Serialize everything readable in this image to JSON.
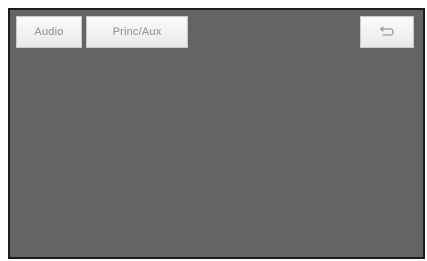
{
  "header": {
    "audio_label": "Audio",
    "source_label": "Princ/Aux",
    "back_icon": "back-arrow-icon"
  },
  "colors": {
    "screen_background": "#646464",
    "button_background": "#f2f2f2",
    "button_text": "#8a8a8a"
  }
}
